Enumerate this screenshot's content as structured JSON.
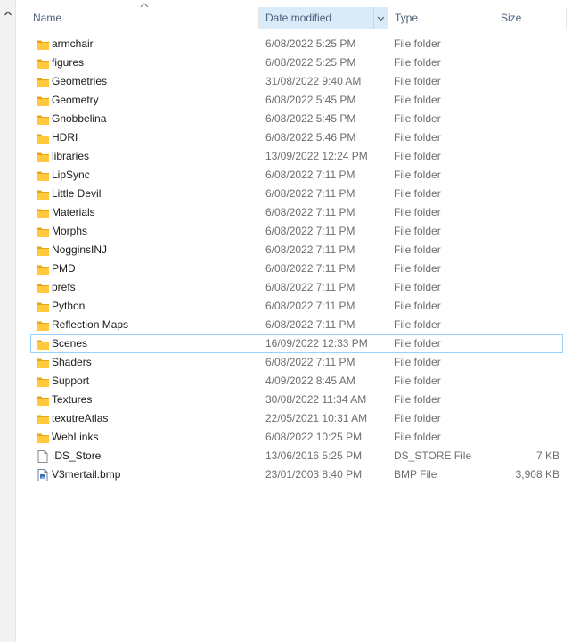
{
  "columns": {
    "name": "Name",
    "date": "Date modified",
    "type": "Type",
    "size": "Size"
  },
  "sorted_column": "date",
  "focused_row": 16,
  "items": [
    {
      "name": "armchair",
      "date": "6/08/2022 5:25 PM",
      "type": "File folder",
      "size": "",
      "icon": "folder-icon"
    },
    {
      "name": "figures",
      "date": "6/08/2022 5:25 PM",
      "type": "File folder",
      "size": "",
      "icon": "folder-icon"
    },
    {
      "name": "Geometries",
      "date": "31/08/2022 9:40 AM",
      "type": "File folder",
      "size": "",
      "icon": "folder-icon"
    },
    {
      "name": "Geometry",
      "date": "6/08/2022 5:45 PM",
      "type": "File folder",
      "size": "",
      "icon": "folder-icon"
    },
    {
      "name": "Gnobbelina",
      "date": "6/08/2022 5:45 PM",
      "type": "File folder",
      "size": "",
      "icon": "folder-icon"
    },
    {
      "name": "HDRI",
      "date": "6/08/2022 5:46 PM",
      "type": "File folder",
      "size": "",
      "icon": "folder-icon"
    },
    {
      "name": "libraries",
      "date": "13/09/2022 12:24 PM",
      "type": "File folder",
      "size": "",
      "icon": "folder-icon"
    },
    {
      "name": "LipSync",
      "date": "6/08/2022 7:11 PM",
      "type": "File folder",
      "size": "",
      "icon": "folder-icon"
    },
    {
      "name": "Little Devil",
      "date": "6/08/2022 7:11 PM",
      "type": "File folder",
      "size": "",
      "icon": "folder-icon"
    },
    {
      "name": "Materials",
      "date": "6/08/2022 7:11 PM",
      "type": "File folder",
      "size": "",
      "icon": "folder-icon"
    },
    {
      "name": "Morphs",
      "date": "6/08/2022 7:11 PM",
      "type": "File folder",
      "size": "",
      "icon": "folder-icon"
    },
    {
      "name": "NogginsINJ",
      "date": "6/08/2022 7:11 PM",
      "type": "File folder",
      "size": "",
      "icon": "folder-icon"
    },
    {
      "name": "PMD",
      "date": "6/08/2022 7:11 PM",
      "type": "File folder",
      "size": "",
      "icon": "folder-icon"
    },
    {
      "name": "prefs",
      "date": "6/08/2022 7:11 PM",
      "type": "File folder",
      "size": "",
      "icon": "folder-icon"
    },
    {
      "name": "Python",
      "date": "6/08/2022 7:11 PM",
      "type": "File folder",
      "size": "",
      "icon": "folder-icon"
    },
    {
      "name": "Reflection Maps",
      "date": "6/08/2022 7:11 PM",
      "type": "File folder",
      "size": "",
      "icon": "folder-icon"
    },
    {
      "name": "Scenes",
      "date": "16/09/2022 12:33 PM",
      "type": "File folder",
      "size": "",
      "icon": "folder-icon"
    },
    {
      "name": "Shaders",
      "date": "6/08/2022 7:11 PM",
      "type": "File folder",
      "size": "",
      "icon": "folder-icon"
    },
    {
      "name": "Support",
      "date": "4/09/2022 8:45 AM",
      "type": "File folder",
      "size": "",
      "icon": "folder-icon"
    },
    {
      "name": "Textures",
      "date": "30/08/2022 11:34 AM",
      "type": "File folder",
      "size": "",
      "icon": "folder-icon"
    },
    {
      "name": "texutreAtlas",
      "date": "22/05/2021 10:31 AM",
      "type": "File folder",
      "size": "",
      "icon": "folder-icon"
    },
    {
      "name": "WebLinks",
      "date": "6/08/2022 10:25 PM",
      "type": "File folder",
      "size": "",
      "icon": "folder-icon"
    },
    {
      "name": ".DS_Store",
      "date": "13/06/2016 5:25 PM",
      "type": "DS_STORE File",
      "size": "7 KB",
      "icon": "file-icon"
    },
    {
      "name": "V3mertail.bmp",
      "date": "23/01/2003 8:40 PM",
      "type": "BMP File",
      "size": "3,908 KB",
      "icon": "bmp-file-icon"
    }
  ],
  "colors": {
    "folder": "#ffc83d",
    "folder_dark": "#e8a317",
    "sorted_header_bg": "#d9ebf9",
    "focus_border": "#99d1ff",
    "header_text": "#4c607a",
    "secondary_text": "#6d6d6d"
  }
}
